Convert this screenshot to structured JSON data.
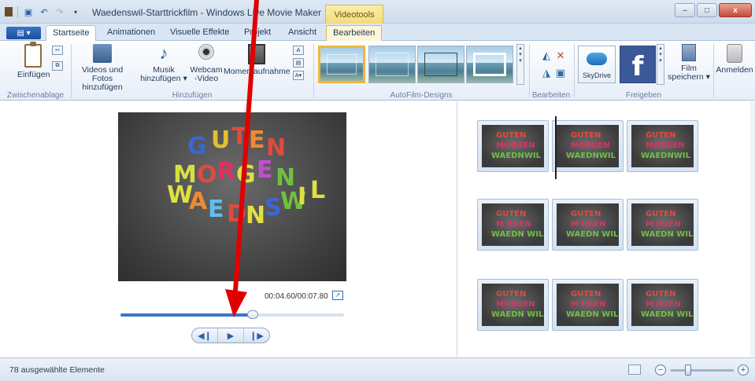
{
  "window": {
    "title": "Waedenswil-Starttrickfilm - Windows Live Movie Maker",
    "contextual_tab_group": "Videotools",
    "controls": {
      "minimize": "–",
      "maximize": "□",
      "close": "x"
    }
  },
  "tabs": {
    "app_button": "▤ ▾",
    "items": [
      "Startseite",
      "Animationen",
      "Visuelle Effekte",
      "Projekt",
      "Ansicht"
    ],
    "contextual": "Bearbeiten",
    "active": "Startseite"
  },
  "ribbon": {
    "clipboard": {
      "paste": "Einfügen",
      "group": "Zwischenablage"
    },
    "add": {
      "videos_photos": [
        "Videos und Fotos",
        "hinzufügen"
      ],
      "music": [
        "Musik",
        "hinzufügen ▾"
      ],
      "webcam": [
        "Webcam",
        "-Video"
      ],
      "snapshot": "Momentaufnahme",
      "group": "Hinzufügen"
    },
    "autofilm": {
      "group": "AutoFilm-Designs"
    },
    "edit": {
      "group": "Bearbeiten"
    },
    "share": {
      "skydrive": "SkyDrive",
      "save_movie": [
        "Film",
        "speichern ▾"
      ],
      "group": "Freigeben"
    },
    "signin": "Anmelden"
  },
  "preview": {
    "title_letters": [
      "G",
      "U",
      "T",
      "E",
      "N",
      "M",
      "O",
      "R",
      "G",
      "E",
      "N",
      "W",
      "A",
      "E",
      "D",
      "N",
      "S",
      "W",
      "I",
      "L"
    ],
    "timecode": "00:04.60/00:07.80",
    "progress_fraction": 0.59,
    "buttons": {
      "prev": "◀❙",
      "play": "▶",
      "next": "❙▶"
    }
  },
  "storyboard": {
    "clips": [
      {
        "lines": [
          "GUTEN",
          "MORGEN",
          "WAEDNWIL"
        ]
      },
      {
        "lines": [
          "GUTEN",
          "MORGEN",
          "WAEDNWIL"
        ]
      },
      {
        "lines": [
          "GUTEN",
          "MORGEN",
          "WAEDNWIL"
        ]
      },
      {
        "lines": [
          "GUTEN",
          "M RGEN",
          "WAEDN WIL"
        ]
      },
      {
        "lines": [
          "GUTEN",
          "M RGEN",
          "WAEDN WIL"
        ]
      },
      {
        "lines": [
          "GUTEN",
          "M RGEN",
          "WAEDN WIL"
        ]
      },
      {
        "lines": [
          "GUTEN",
          "MORGEN",
          "WAEDN WIL"
        ]
      },
      {
        "lines": [
          "GUTEN",
          "M RGEN",
          "WAEDN WIL"
        ]
      },
      {
        "lines": [
          "GUTEN",
          "M RGEN",
          "WAEDN WIL"
        ]
      }
    ]
  },
  "status": {
    "selection": "78 ausgewählte Elemente",
    "zoom_minus": "−",
    "zoom_plus": "+"
  },
  "colors": {
    "accent": "#3a76c4",
    "annotation_arrow": "#e00000"
  }
}
